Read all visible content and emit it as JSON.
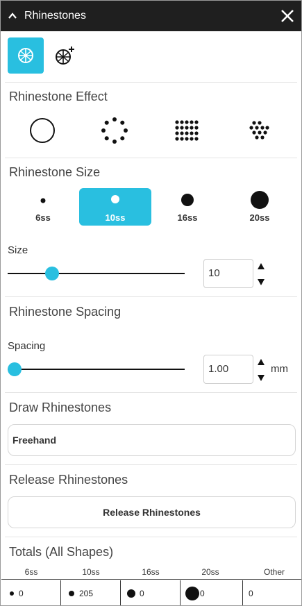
{
  "window": {
    "title": "Rhinestones",
    "collapse_icon": "chevron-up-icon",
    "close_icon": "close-icon"
  },
  "modes": [
    {
      "name": "rhinestone-mode-icon",
      "active": true
    },
    {
      "name": "add-rhinestone-mode-icon",
      "active": false
    }
  ],
  "effect": {
    "title": "Rhinestone Effect",
    "options": [
      "circle-outline-icon",
      "dotted-circle-icon",
      "grid-pattern-icon",
      "scatter-pattern-icon"
    ]
  },
  "size_section": {
    "title": "Rhinestone Size",
    "options": [
      {
        "label": "6ss",
        "active": false
      },
      {
        "label": "10ss",
        "active": true
      },
      {
        "label": "16ss",
        "active": false
      },
      {
        "label": "20ss",
        "active": false
      }
    ],
    "size_label": "Size",
    "size_value": "10",
    "size_slider_fraction": 0.25
  },
  "spacing": {
    "title": "Rhinestone Spacing",
    "label": "Spacing",
    "value": "1.00",
    "unit": "mm",
    "slider_fraction": 0.0
  },
  "draw": {
    "title": "Draw Rhinestones",
    "button": "Freehand"
  },
  "release": {
    "title": "Release Rhinestones",
    "button": "Release Rhinestones"
  },
  "totals": {
    "title": "Totals (All Shapes)",
    "headers": [
      "6ss",
      "10ss",
      "16ss",
      "20ss",
      "Other"
    ],
    "values": [
      "0",
      "205",
      "0",
      "0",
      "0"
    ]
  },
  "colors": {
    "accent": "#29bfe0",
    "titlebar": "#1f1f1f"
  }
}
